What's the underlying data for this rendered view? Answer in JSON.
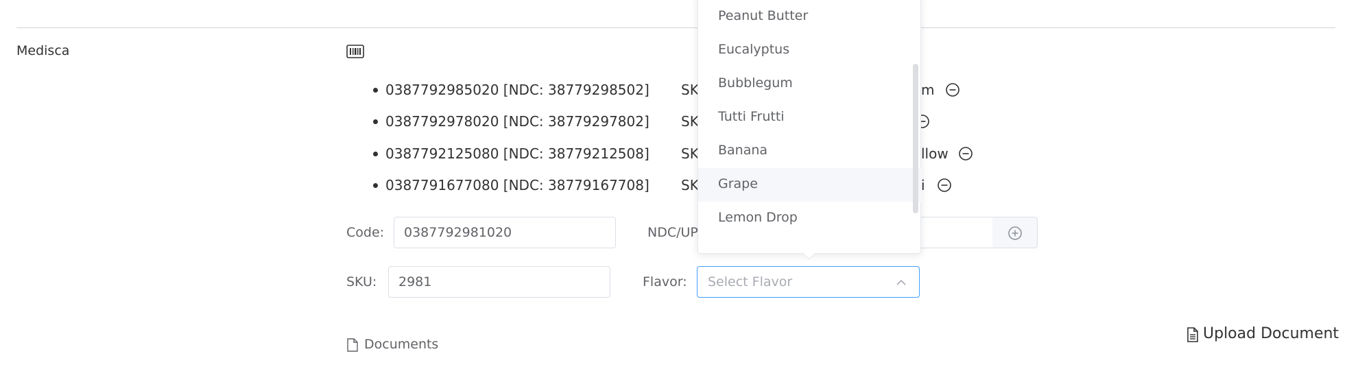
{
  "vendor": {
    "name": "Medisca",
    "icon": "barcode-icon"
  },
  "codes": [
    {
      "text": "0387792985020 [NDC: 38779298502]",
      "sku_fragment": "SK",
      "flavor_fragment": "m"
    },
    {
      "text": "0387792978020 [NDC: 38779297802]",
      "sku_fragment": "SK",
      "flavor_fragment": ""
    },
    {
      "text": "0387792125080 [NDC: 38779212508]",
      "sku_fragment": "SK",
      "flavor_fragment": "llow"
    },
    {
      "text": "0387791677080 [NDC: 38779167708]",
      "sku_fragment": "SK",
      "flavor_fragment": "i"
    }
  ],
  "form": {
    "code_label": "Code:",
    "code_value": "0387792981020",
    "ndc_label": "NDC/UP",
    "sku_label": "SKU:",
    "sku_value": "2981",
    "flavor_label": "Flavor:",
    "flavor_placeholder": "Select Flavor"
  },
  "dropdown": {
    "options": [
      "Peanut Butter",
      "Eucalyptus",
      "Bubblegum",
      "Tutti Frutti",
      "Banana",
      "Grape",
      "Lemon Drop"
    ],
    "hovered": "Grape"
  },
  "documents": {
    "label": "Documents",
    "upload_label": "Upload Document"
  },
  "colors": {
    "accent": "#409eff",
    "border": "#dcdfe6",
    "text": "#303133",
    "muted": "#606266"
  }
}
